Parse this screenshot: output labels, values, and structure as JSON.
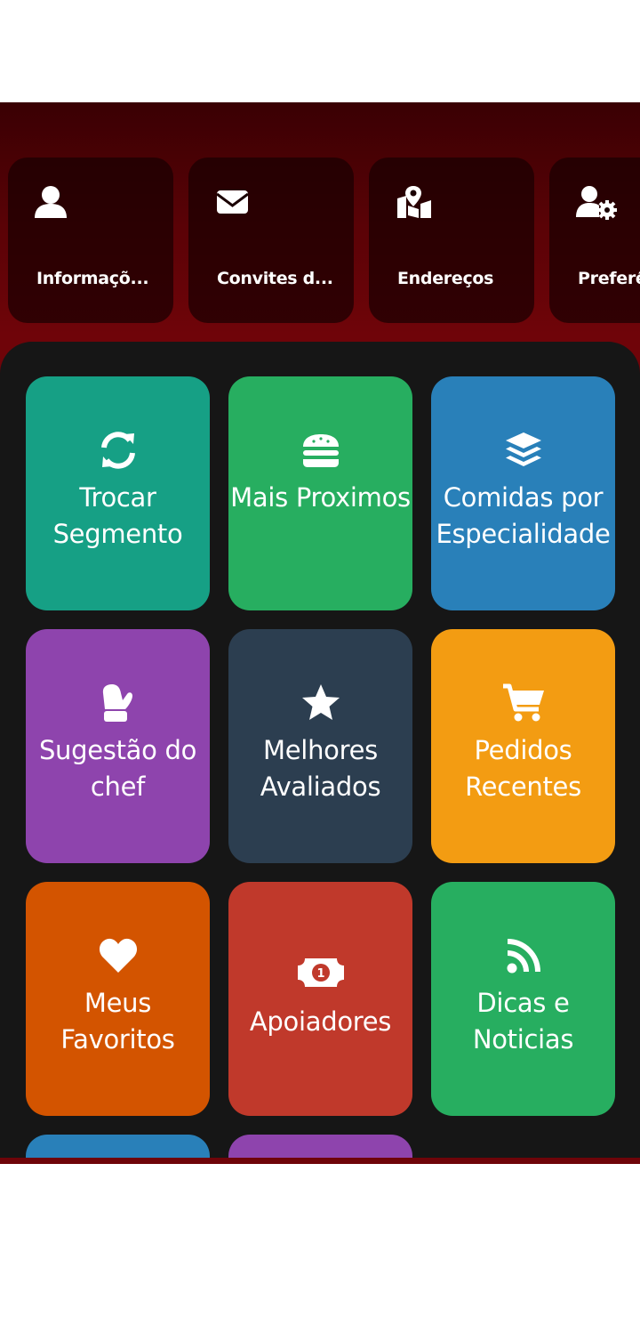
{
  "quick_cards": [
    {
      "label": "Informaçõ...",
      "icon": "user-icon"
    },
    {
      "label": "Convites d...",
      "icon": "envelope-icon"
    },
    {
      "label": "Endereços",
      "icon": "map-marker-icon"
    },
    {
      "label": "Preferê",
      "icon": "user-gear-icon"
    }
  ],
  "tiles": [
    {
      "label": "Trocar Segmento",
      "icon": "refresh-icon",
      "color": "#16a085"
    },
    {
      "label": "Mais Proximos",
      "icon": "hamburger-icon",
      "color": "#27ae60"
    },
    {
      "label": "Comidas por Especialidade",
      "icon": "layers-icon",
      "color": "#2980b9"
    },
    {
      "label": "Sugestão do chef",
      "icon": "oven-mitt-icon",
      "color": "#8e44ad"
    },
    {
      "label": "Melhores Avaliados",
      "icon": "star-icon",
      "color": "#2c3e50"
    },
    {
      "label": "Pedidos Recentes",
      "icon": "shopping-cart-icon",
      "color": "#f39c12"
    },
    {
      "label": "Meus Favoritos",
      "icon": "heart-icon",
      "color": "#d35400"
    },
    {
      "label": "Apoiadores",
      "icon": "money-bill-icon",
      "color": "#c0392b"
    },
    {
      "label": "Dicas e Noticias",
      "icon": "rss-icon",
      "color": "#27ae60"
    },
    {
      "label": "",
      "icon": "",
      "color": "#2980b9"
    },
    {
      "label": "",
      "icon": "",
      "color": "#8e44ad"
    }
  ],
  "colors": {
    "header_dark": "#3a0003",
    "header_red": "#6f0409",
    "panel_bg": "#161616"
  }
}
